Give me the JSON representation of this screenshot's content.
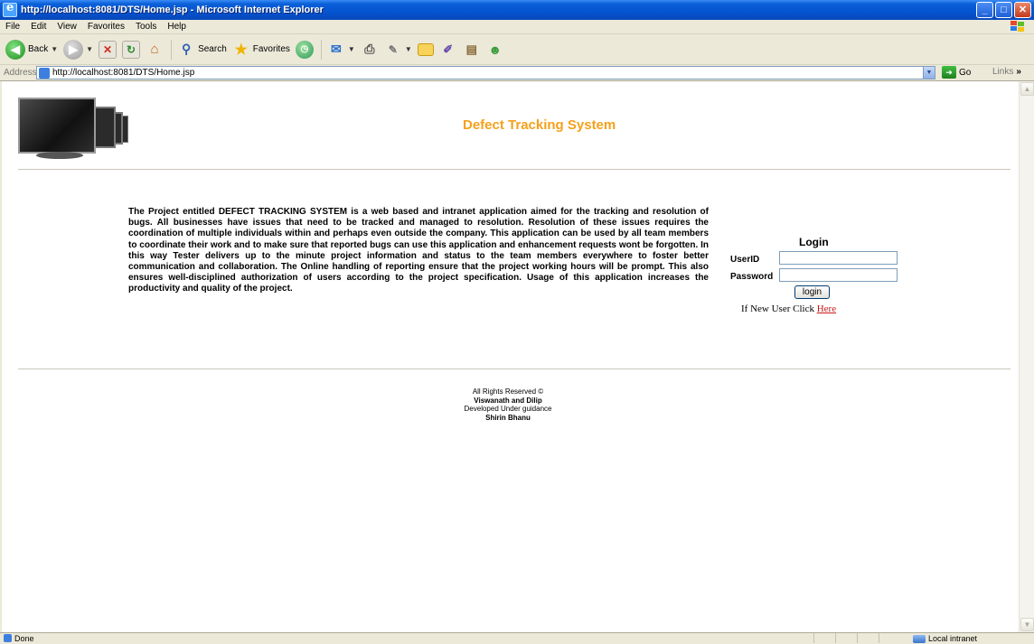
{
  "window": {
    "title": "http://localhost:8081/DTS/Home.jsp - Microsoft Internet Explorer",
    "buttons": {
      "minimize": "_",
      "maximize": "□",
      "close": "✕"
    }
  },
  "menu": [
    "File",
    "Edit",
    "View",
    "Favorites",
    "Tools",
    "Help"
  ],
  "toolbar": {
    "back_label": "Back",
    "search_label": "Search",
    "favorites_label": "Favorites"
  },
  "address": {
    "label": "Address",
    "url": "http://localhost:8081/DTS/Home.jsp",
    "go_label": "Go",
    "links_label": "Links"
  },
  "page": {
    "title": "Defect Tracking System",
    "description": "The Project entitled DEFECT TRACKING SYSTEM is a web based and intranet application aimed for the tracking and resolution of bugs. All businesses have issues that need to be tracked and managed to resolution. Resolution of these issues requires the coordination of multiple individuals within and perhaps even outside the company. This application can be used by all team members to coordinate their work and to make sure that reported bugs can use this application and enhancement requests wont be forgotten. In this way Tester delivers up to the minute project information and status to the team members everywhere to foster better communication and collaboration. The Online handling of reporting ensure that the project working hours will be prompt. This also ensures well-disciplined authorization of users according to the project specification. Usage of this application increases the productivity and quality of the project.",
    "login": {
      "heading": "Login",
      "userid_label": "UserID",
      "userid_value": "",
      "password_label": "Password",
      "password_value": "",
      "button_label": "login",
      "new_user_text": "If New User Click ",
      "new_user_link": "Here"
    },
    "footer": {
      "line1": "All Rights Reserved ©",
      "line2": "Viswanath and Dilip",
      "line3": "Developed Under guidance",
      "line4": "Shirin Bhanu"
    }
  },
  "status": {
    "text": "Done",
    "zone": "Local intranet"
  }
}
